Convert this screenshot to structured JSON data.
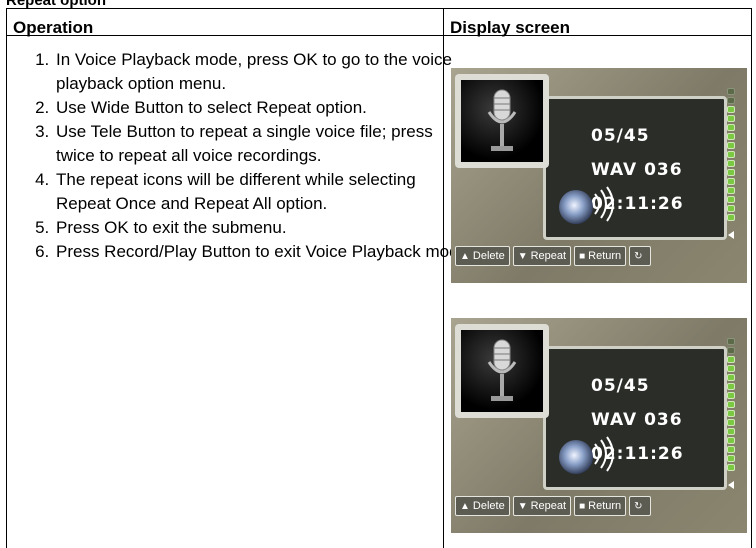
{
  "section_title": "Repeat option",
  "table": {
    "col_operation": "Operation",
    "col_display": "Display screen"
  },
  "steps": [
    "In Voice Playback mode, press OK to go to the voice playback option menu.",
    "Use Wide Button to select Repeat option.",
    "Use Tele Button to repeat a single voice file; press twice to repeat all voice recordings.",
    "The repeat icons will be different while selecting Repeat Once and Repeat All option.",
    "Press OK to exit the submenu.",
    "Press Record/Play Button to exit Voice Playback mode."
  ],
  "screens": [
    {
      "file_index": "05/45",
      "file_name": "WAV 036",
      "time": "02:11:26",
      "buttons": {
        "delete": "Delete",
        "repeat": "Repeat",
        "return": "Return"
      },
      "meter_level": 0.87
    },
    {
      "file_index": "05/45",
      "file_name": "WAV 036",
      "time": "02:11:26",
      "buttons": {
        "delete": "Delete",
        "repeat": "Repeat",
        "return": "Return"
      },
      "meter_level": 0.87
    }
  ],
  "colors": {
    "meter_on": "#7bc943",
    "panel": "#2a2d28",
    "screen_bg": "#8f8b78"
  },
  "icons": [
    "microphone-icon",
    "speaker-icon",
    "up-arrow-icon",
    "down-arrow-icon",
    "square-icon",
    "repeat-icon"
  ]
}
